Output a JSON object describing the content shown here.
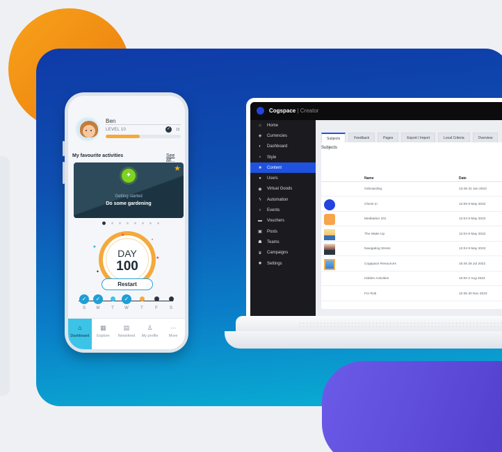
{
  "colors": {
    "accent_orange": "#f4a93a",
    "cyan": "#3cc3e8",
    "blue_card": "#0e4fb0",
    "sidebar_active": "#2052e0",
    "purple": "#5a47d6"
  },
  "phone": {
    "profile": {
      "name": "Ben",
      "level": "LEVEL 10",
      "percent": "15",
      "progress_fraction": 0.45
    },
    "favourites": {
      "title": "My favourite activities",
      "see_all": "See all..."
    },
    "activity": {
      "subtitle": "Getting started",
      "title": "Do some gardening",
      "icon": "lightbulb-icon"
    },
    "day": {
      "label": "DAY",
      "number": "100",
      "restart": "Restart"
    },
    "week": [
      {
        "letter": "S",
        "state": "done"
      },
      {
        "letter": "M",
        "state": "done"
      },
      {
        "letter": "T",
        "state": "partial"
      },
      {
        "letter": "W",
        "state": "done"
      },
      {
        "letter": "T",
        "state": "today"
      },
      {
        "letter": "F",
        "state": "future"
      },
      {
        "letter": "S",
        "state": "future"
      }
    ],
    "tabs": [
      {
        "label": "Dashboard",
        "icon": "home-icon",
        "glyph": "⌂"
      },
      {
        "label": "Explore",
        "icon": "grid-icon",
        "glyph": "▦"
      },
      {
        "label": "Newsfeed",
        "icon": "chat-icon",
        "glyph": "▤"
      },
      {
        "label": "My profile",
        "icon": "user-icon",
        "glyph": "♙"
      },
      {
        "label": "More",
        "icon": "more-icon",
        "glyph": "⋯"
      }
    ]
  },
  "laptop": {
    "brand_bold": "Cogspace",
    "brand_rest": "| Creator",
    "sidebar": [
      {
        "label": "Home",
        "icon": "home-icon",
        "glyph": "⌂"
      },
      {
        "label": "Currencies",
        "icon": "currency-icon",
        "glyph": "◈"
      },
      {
        "label": "Dashboard",
        "icon": "dashboard-icon",
        "glyph": "◐"
      },
      {
        "label": "Style",
        "icon": "style-icon",
        "glyph": "♆"
      },
      {
        "label": "Content",
        "icon": "content-icon",
        "glyph": "■"
      },
      {
        "label": "Users",
        "icon": "user-icon",
        "glyph": "●"
      },
      {
        "label": "Virtual Goods",
        "icon": "goods-icon",
        "glyph": "◉"
      },
      {
        "label": "Automation",
        "icon": "automation-icon",
        "glyph": "ϟ"
      },
      {
        "label": "Events",
        "icon": "events-icon",
        "glyph": "♁"
      },
      {
        "label": "Vouchers",
        "icon": "voucher-icon",
        "glyph": "▬"
      },
      {
        "label": "Posts",
        "icon": "posts-icon",
        "glyph": "▣"
      },
      {
        "label": "Teams",
        "icon": "teams-icon",
        "glyph": "☗"
      },
      {
        "label": "Campaigns",
        "icon": "trophy-icon",
        "glyph": "♛"
      },
      {
        "label": "Settings",
        "icon": "settings-icon",
        "glyph": "✹"
      }
    ],
    "active_sidebar_index": 4,
    "tabs": [
      "Subjects",
      "Feedback",
      "Pages",
      "Export / Import",
      "Local Criteria",
      "Overview"
    ],
    "panel_title": "Subjects",
    "table": {
      "headers": [
        "Name",
        "Date"
      ],
      "rows": [
        {
          "name": "Onboarding",
          "date": "13:48 31 Jan 2023",
          "thumb": "none"
        },
        {
          "name": "Check in",
          "date": "12:06 9 May 2022",
          "thumb": "blue-dot"
        },
        {
          "name": "Meditation 101",
          "date": "12:04 9 May 2022",
          "thumb": "orange"
        },
        {
          "name": "The Wake Up",
          "date": "12:04 9 May 2022",
          "thumb": "sunrise"
        },
        {
          "name": "Navigating Stress",
          "date": "12:04 9 May 2022",
          "thumb": "person"
        },
        {
          "name": "Cogspace Resources",
          "date": "16:45 28 Jul 2022",
          "thumb": "box"
        },
        {
          "name": "Hidden Activities",
          "date": "10:00 2 Aug 2022",
          "thumb": "none"
        },
        {
          "name": "For Rob",
          "date": "10:35 30 Nov 2023",
          "thumb": "none"
        }
      ]
    }
  }
}
